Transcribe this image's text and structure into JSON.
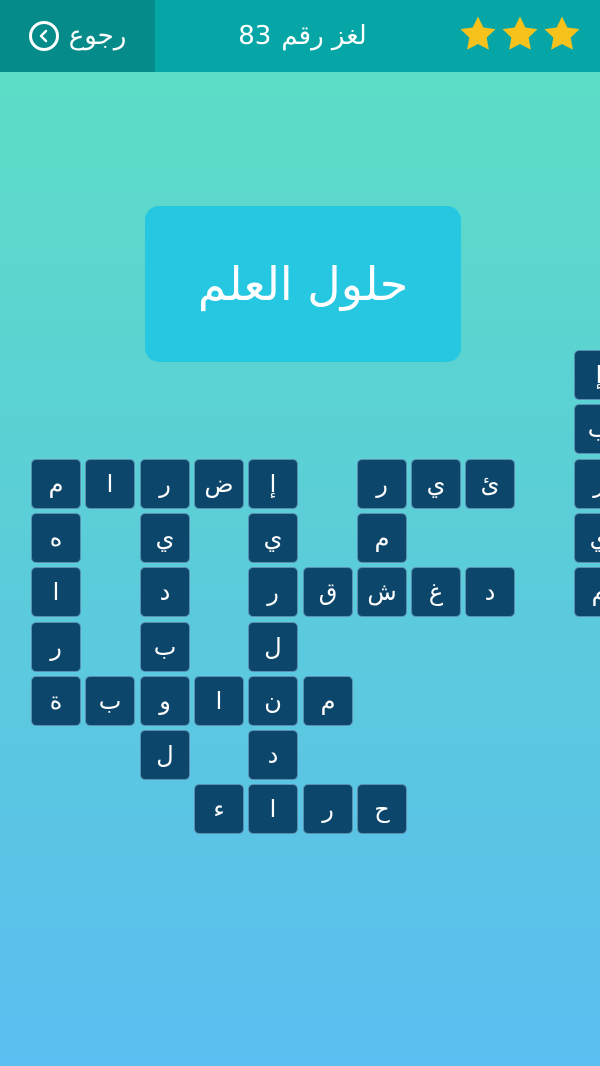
{
  "header": {
    "back_label": "رجوع",
    "back_icon": "chevron-left-circle-icon",
    "title_word": "لغز رقم",
    "title_number": "83",
    "stars_earned": 3,
    "stars_total": 3,
    "star_color": "#f7c21b"
  },
  "answer": {
    "text": "حلول العلم",
    "color": "#25c8e0"
  },
  "colors": {
    "header_bg": "#06a5a6",
    "back_bg": "#058b89",
    "tile_bg": "#0d466b"
  },
  "tiles": [
    {
      "row": 0,
      "col": 10,
      "letter": "إ"
    },
    {
      "row": 1,
      "col": 10,
      "letter": "ب"
    },
    {
      "row": 2,
      "col": 0,
      "letter": "م"
    },
    {
      "row": 2,
      "col": 1,
      "letter": "ا"
    },
    {
      "row": 2,
      "col": 2,
      "letter": "ر"
    },
    {
      "row": 2,
      "col": 3,
      "letter": "ض"
    },
    {
      "row": 2,
      "col": 4,
      "letter": "إ"
    },
    {
      "row": 2,
      "col": 6,
      "letter": "ر"
    },
    {
      "row": 2,
      "col": 7,
      "letter": "ي"
    },
    {
      "row": 2,
      "col": 8,
      "letter": "ئ"
    },
    {
      "row": 2,
      "col": 10,
      "letter": "ز"
    },
    {
      "row": 3,
      "col": 0,
      "letter": "ه"
    },
    {
      "row": 3,
      "col": 2,
      "letter": "ي"
    },
    {
      "row": 3,
      "col": 4,
      "letter": "ي"
    },
    {
      "row": 3,
      "col": 6,
      "letter": "م"
    },
    {
      "row": 3,
      "col": 10,
      "letter": "ي"
    },
    {
      "row": 4,
      "col": 0,
      "letter": "ا"
    },
    {
      "row": 4,
      "col": 2,
      "letter": "د"
    },
    {
      "row": 4,
      "col": 4,
      "letter": "ر"
    },
    {
      "row": 4,
      "col": 5,
      "letter": "ق"
    },
    {
      "row": 4,
      "col": 6,
      "letter": "ش"
    },
    {
      "row": 4,
      "col": 7,
      "letter": "غ"
    },
    {
      "row": 4,
      "col": 8,
      "letter": "د"
    },
    {
      "row": 4,
      "col": 10,
      "letter": "م"
    },
    {
      "row": 5,
      "col": 0,
      "letter": "ر"
    },
    {
      "row": 5,
      "col": 2,
      "letter": "ب"
    },
    {
      "row": 5,
      "col": 4,
      "letter": "ل"
    },
    {
      "row": 6,
      "col": 0,
      "letter": "ة"
    },
    {
      "row": 6,
      "col": 1,
      "letter": "ب"
    },
    {
      "row": 6,
      "col": 2,
      "letter": "و"
    },
    {
      "row": 6,
      "col": 3,
      "letter": "ا"
    },
    {
      "row": 6,
      "col": 4,
      "letter": "ن"
    },
    {
      "row": 6,
      "col": 5,
      "letter": "م"
    },
    {
      "row": 7,
      "col": 2,
      "letter": "ل"
    },
    {
      "row": 7,
      "col": 4,
      "letter": "د"
    },
    {
      "row": 8,
      "col": 3,
      "letter": "ء"
    },
    {
      "row": 8,
      "col": 4,
      "letter": "ا"
    },
    {
      "row": 8,
      "col": 5,
      "letter": "ر"
    },
    {
      "row": 8,
      "col": 6,
      "letter": "ح"
    }
  ]
}
